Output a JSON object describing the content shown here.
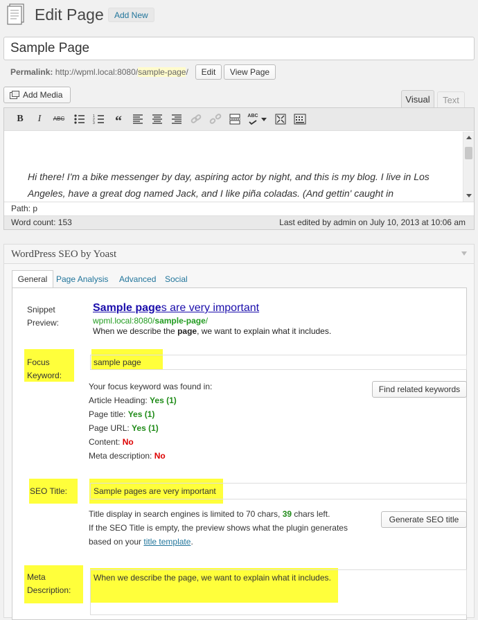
{
  "header": {
    "title": "Edit Page",
    "add_new": "Add New"
  },
  "post_title": "Sample Page",
  "permalink": {
    "label": "Permalink:",
    "base": "http://wpml.local:8080/",
    "slug": "sample-page",
    "trail": "/",
    "edit_label": "Edit",
    "view_label": "View Page"
  },
  "editor": {
    "add_media": "Add Media",
    "tab_visual": "Visual",
    "tab_text": "Text",
    "toolbar": {
      "bold": "B",
      "italic": "I",
      "strike": "ABC",
      "ul": "list",
      "ol": "ordered-list",
      "quote": "“",
      "align_left": "align-left",
      "align_center": "align-center",
      "align_right": "align-right",
      "link": "link",
      "unlink": "unlink",
      "more": "more",
      "spell": "ABC",
      "fullscreen": "fullscreen",
      "kitchen": "kitchen-sink"
    },
    "content": "Hi there! I'm a bike messenger by day, aspiring actor by night, and this is my blog. I live in Los Angeles, have a great dog named Jack, and I like piña coladas. (And gettin' caught in",
    "path": "Path: p",
    "word_count": "Word count: 153",
    "last_edited": "Last edited by admin on July 10, 2013 at 10:06 am"
  },
  "seo": {
    "box_title": "WordPress SEO by Yoast",
    "tabs": [
      "General",
      "Page Analysis",
      "Advanced",
      "Social"
    ],
    "snippet_label_1": "Snippet",
    "snippet_label_2": "Preview:",
    "snippet_title_bold": "Sample page",
    "snippet_title_rest": "s are very important",
    "snippet_url_base": "wpml.local:8080/",
    "snippet_url_slug": "sample-page",
    "snippet_url_trail": "/",
    "snippet_desc_pre": "When we describe the ",
    "snippet_desc_bold": "page",
    "snippet_desc_post": ", we want to explain what it includes.",
    "focus_label_1": "Focus",
    "focus_label_2": "Keyword:",
    "focus_value": "sample page",
    "found_in": "Your focus keyword was found in:",
    "find_related": "Find related keywords",
    "checks": [
      {
        "label": "Article Heading: ",
        "result": "Yes (1)",
        "ok": true
      },
      {
        "label": "Page title: ",
        "result": "Yes (1)",
        "ok": true
      },
      {
        "label": "Page URL: ",
        "result": "Yes (1)",
        "ok": true
      },
      {
        "label": "Content: ",
        "result": "No",
        "ok": false
      },
      {
        "label": "Meta description: ",
        "result": "No",
        "ok": false
      }
    ],
    "seo_title_label": "SEO Title:",
    "seo_title_value": "Sample pages are very important",
    "title_info_pre": "Title display in search engines is limited to 70 chars, ",
    "title_info_count": "39",
    "title_info_post": " chars left.",
    "title_info_2": "If the SEO Title is empty, the preview shows what the plugin generates",
    "title_info_3_pre": "based on your ",
    "title_info_3_link": "title template",
    "title_info_3_post": ".",
    "generate_title": "Generate SEO title",
    "meta_label_1": "Meta",
    "meta_label_2": "Description:",
    "meta_value": "When we describe the page, we want to explain what it includes."
  }
}
